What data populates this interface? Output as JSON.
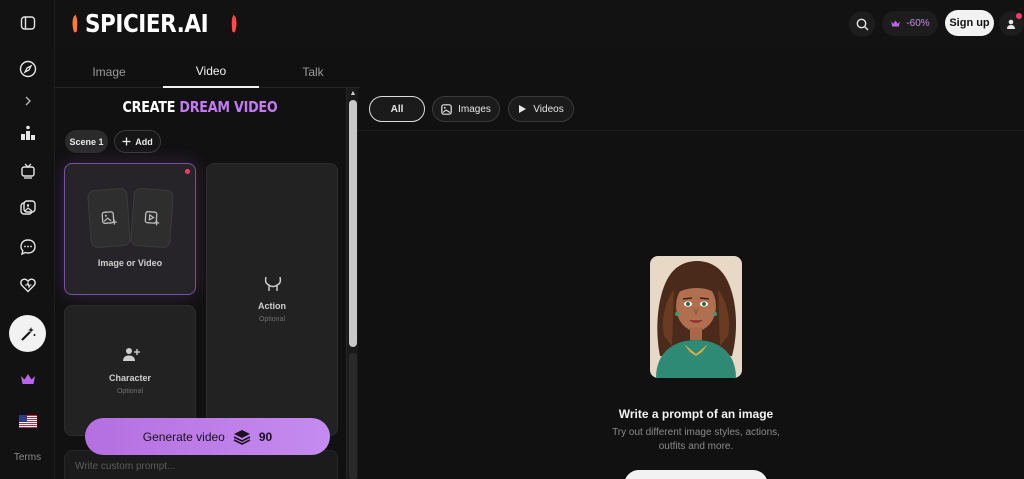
{
  "brand": {
    "logo_text": "SPICIER.AI"
  },
  "header": {
    "promo_text": "-60%",
    "signup_label": "Sign up"
  },
  "rail": {
    "terms_label": "Terms"
  },
  "mode_tabs": [
    {
      "label": "Image"
    },
    {
      "label": "Video"
    },
    {
      "label": "Talk"
    }
  ],
  "panel": {
    "title_white": "CREATE ",
    "title_accent": "DREAM VIDEO",
    "scene_label": "Scene 1",
    "add_label": "Add",
    "media_card_label": "Image or Video",
    "action_label": "Action",
    "action_sub": "Optional",
    "character_label": "Character",
    "character_sub": "Optional",
    "prompt_placeholder": "Write custom prompt...",
    "generate_label": "Generate video",
    "generate_cost": "90"
  },
  "filters": [
    {
      "label": "All"
    },
    {
      "label": "Images"
    },
    {
      "label": "Videos"
    }
  ],
  "empty_state": {
    "title": "Write a prompt of an image",
    "subtitle": "Try out different image styles, actions, outfits and more."
  },
  "colors": {
    "accent": "#c27bf0",
    "notification": "#ff3b6b",
    "background": "#111111"
  }
}
